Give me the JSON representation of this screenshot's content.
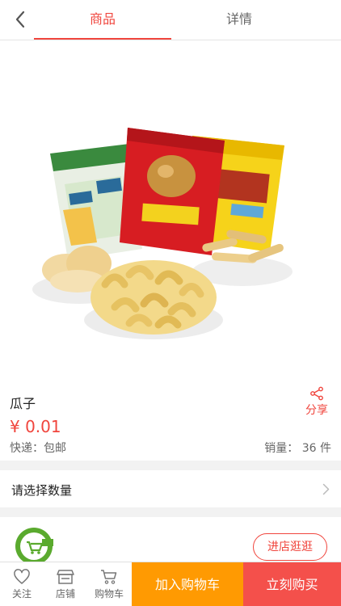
{
  "tabs": [
    {
      "label": "商品",
      "active": true
    },
    {
      "label": "详情",
      "active": false
    }
  ],
  "product": {
    "name": "瓜子",
    "price": "¥ 0.01",
    "shipping": "快递：包邮",
    "sales": "销量：  36 件",
    "share_label": "分享"
  },
  "quantity": {
    "label": "请选择数量"
  },
  "shop": {
    "enter_label": "进店逛逛"
  },
  "bottom_bar": {
    "follow": "关注",
    "store": "店铺",
    "cart": "购物车",
    "add_to_cart": "加入购物车",
    "buy_now": "立刻购买"
  },
  "colors": {
    "accent": "#f0453d",
    "add_cart": "#ff9a02",
    "buy_now": "#f4504b"
  },
  "icons": [
    "back-icon",
    "share-icon",
    "chevron-right-icon",
    "heart-icon",
    "store-icon",
    "cart-icon",
    "shop-logo-icon"
  ]
}
